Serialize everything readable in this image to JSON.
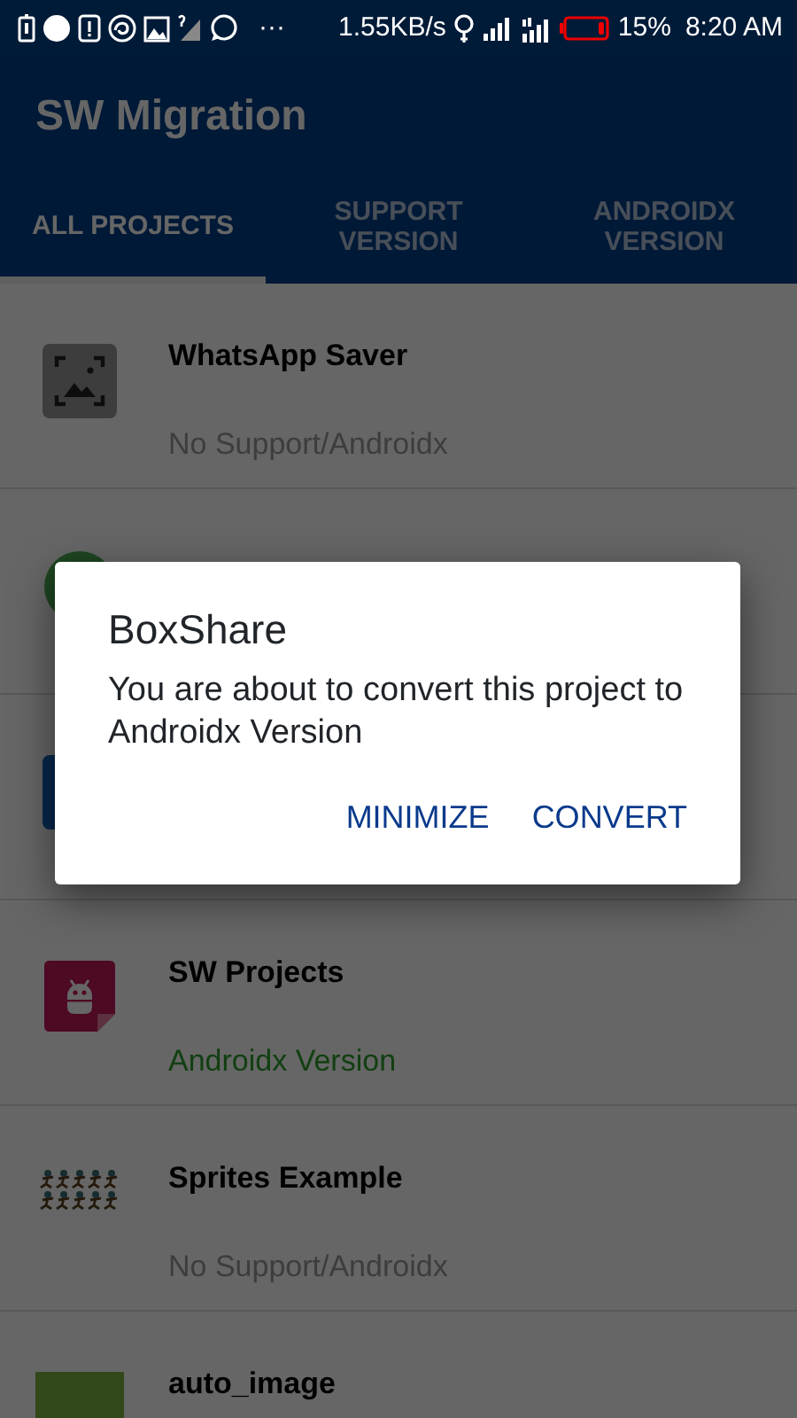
{
  "status_bar": {
    "more": "···",
    "speed": "1.55KB/s",
    "battery": "15%",
    "time": "8:20 AM"
  },
  "app_bar": {
    "title": "SW Migration"
  },
  "tabs": [
    {
      "label": "ALL PROJECTS",
      "selected": true
    },
    {
      "label": "SUPPORT VERSION",
      "selected": false
    },
    {
      "label": "ANDROIDX VERSION",
      "selected": false
    }
  ],
  "projects": [
    {
      "title": "WhatsApp Saver",
      "status": "No Support/Androidx",
      "kind": "none"
    },
    {
      "title": "SW Projects",
      "status": "Androidx Version",
      "kind": "androidx"
    },
    {
      "title": "Sprites Example",
      "status": "No Support/Androidx",
      "kind": "none"
    },
    {
      "title": "auto_image"
    }
  ],
  "dialog": {
    "title": "BoxShare",
    "message": "You are about to convert this project to Androidx Version",
    "buttons": [
      "MINIMIZE",
      "CONVERT"
    ]
  }
}
